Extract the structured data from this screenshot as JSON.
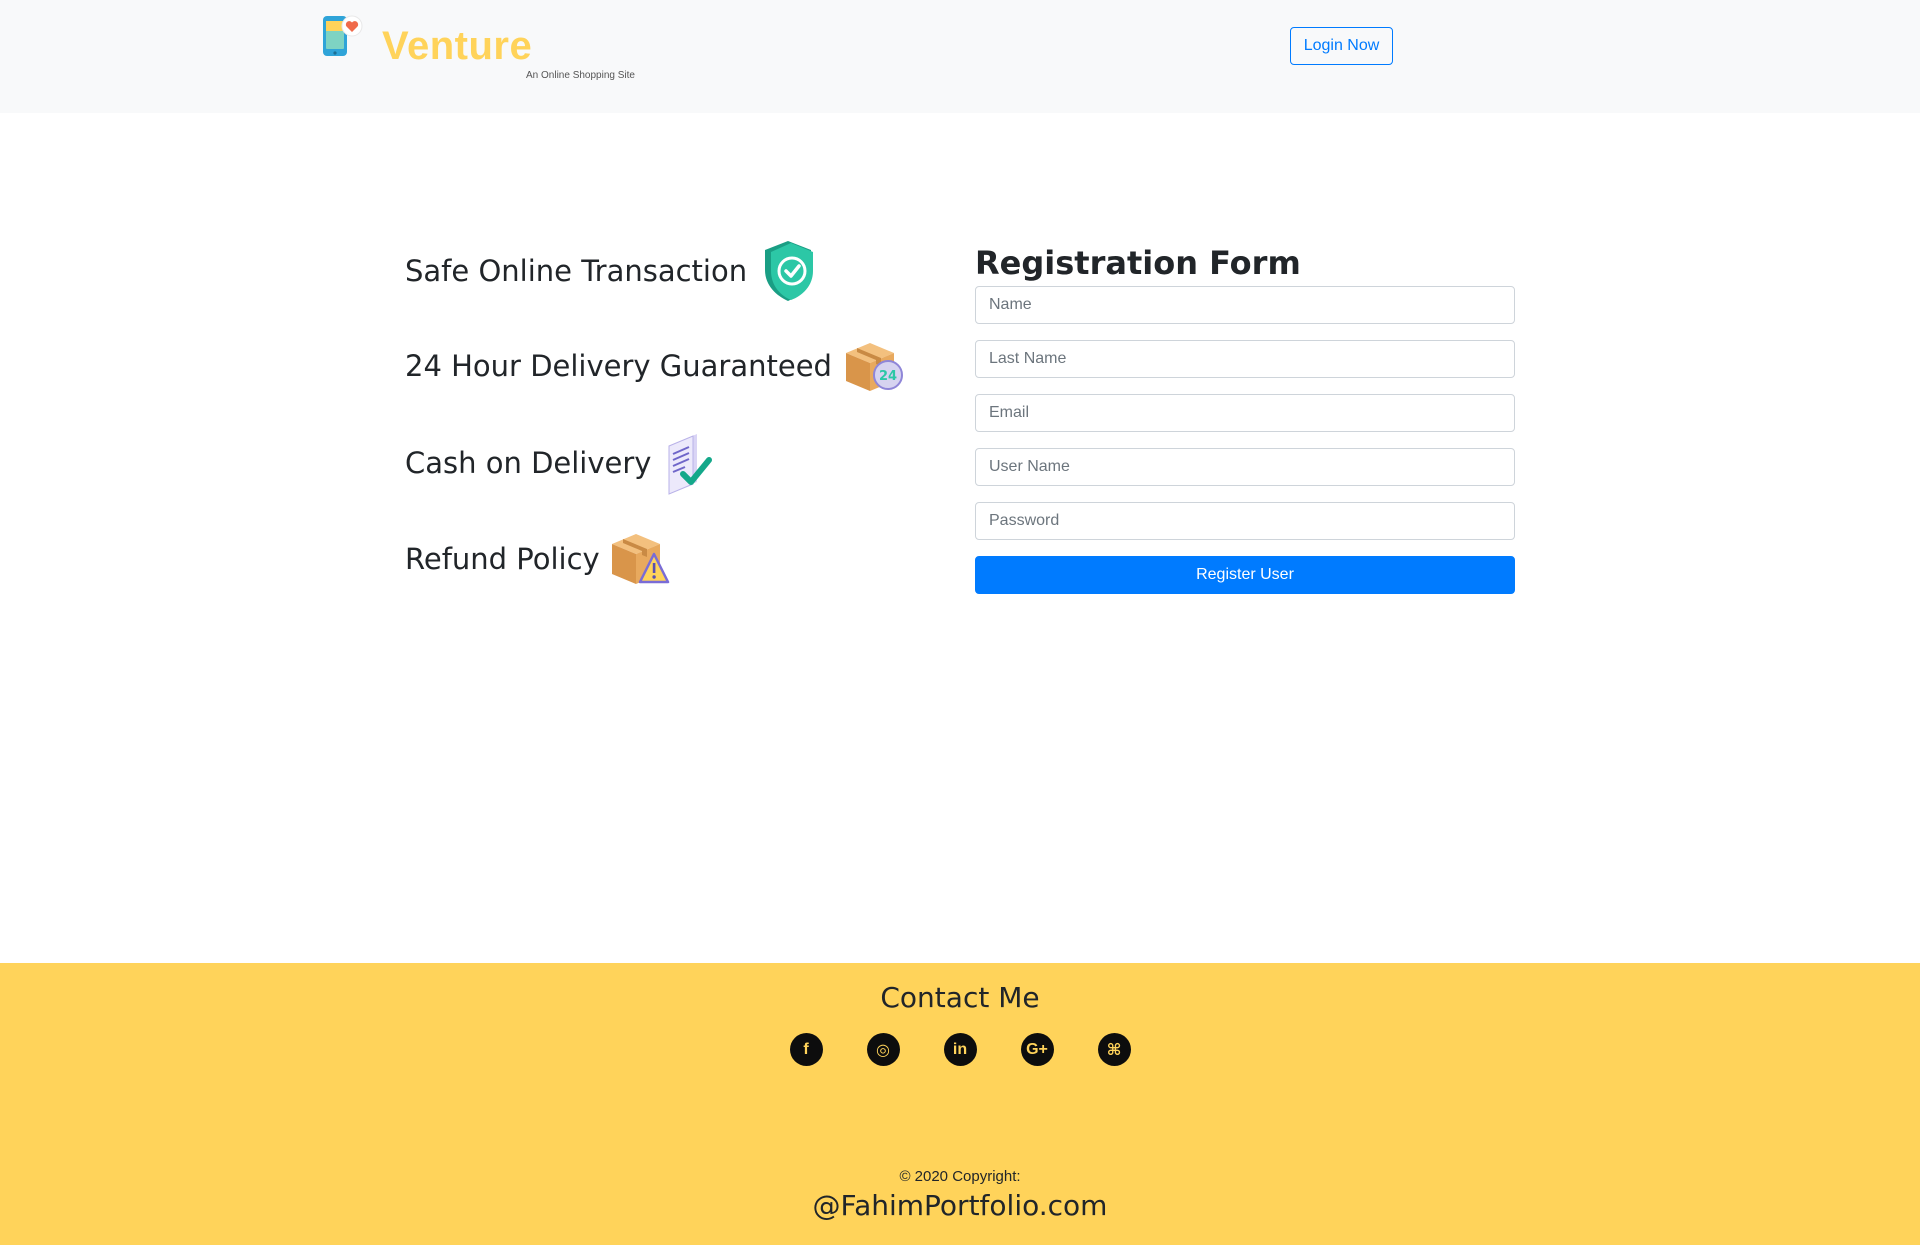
{
  "header": {
    "brand_name": "Venture",
    "tagline": "An Online Shopping Site",
    "login_label": "Login Now"
  },
  "features": [
    {
      "label": "Safe Online Transaction",
      "icon": "shield-check-icon"
    },
    {
      "label": "24 Hour Delivery Guaranteed",
      "icon": "box-24h-icon"
    },
    {
      "label": "Cash on Delivery",
      "icon": "document-check-icon"
    },
    {
      "label": "Refund Policy",
      "icon": "box-warning-icon"
    }
  ],
  "form": {
    "title": "Registration Form",
    "fields": [
      {
        "placeholder": "Name",
        "value": ""
      },
      {
        "placeholder": "Last Name",
        "value": ""
      },
      {
        "placeholder": "Email",
        "value": ""
      },
      {
        "placeholder": "User Name",
        "value": ""
      },
      {
        "placeholder": "Password",
        "value": ""
      }
    ],
    "submit_label": "Register User"
  },
  "footer": {
    "title": "Contact Me",
    "socials": [
      {
        "name": "facebook-icon",
        "glyph": "f"
      },
      {
        "name": "instagram-icon",
        "glyph": "◎"
      },
      {
        "name": "linkedin-icon",
        "glyph": "in"
      },
      {
        "name": "google-plus-icon",
        "glyph": "G+"
      },
      {
        "name": "github-icon",
        "glyph": "⌘"
      }
    ],
    "copyright": "© 2020 Copyright:",
    "site": "@FahimPortfolio.com"
  },
  "colors": {
    "brand_yellow": "#ffd35a",
    "primary_blue": "#007bff",
    "header_bg": "#f8f9fa"
  }
}
